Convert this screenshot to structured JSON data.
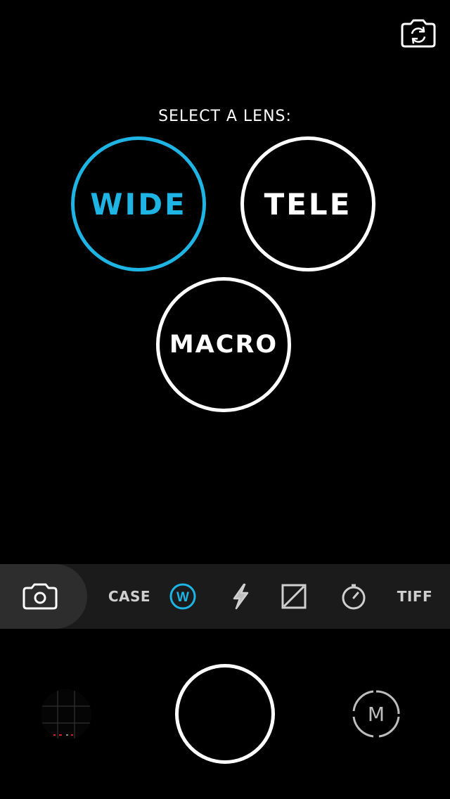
{
  "viewfinder": {
    "prompt": "SELECT A LENS:",
    "lenses": [
      {
        "label": "WIDE",
        "selected": true
      },
      {
        "label": "TELE",
        "selected": false
      },
      {
        "label": "MACRO",
        "selected": false
      }
    ],
    "flip_camera_icon": "camera-flip-icon"
  },
  "toolbar": {
    "mode_icon": "camera-icon",
    "case_label": "CASE",
    "lens_badge": "W",
    "flash_icon": "flash-icon",
    "exposure_icon": "exposure-icon",
    "timer_icon": "timer-icon",
    "format_label": "TIFF"
  },
  "bottom": {
    "thumbnail_icon": "last-photo-thumbnail",
    "shutter_icon": "shutter-button",
    "manual_label": "M"
  },
  "colors": {
    "accent": "#1eb4e4",
    "background": "#000000",
    "toolbar": "#1b1b1b",
    "mode_highlight": "#2d2d2d"
  }
}
